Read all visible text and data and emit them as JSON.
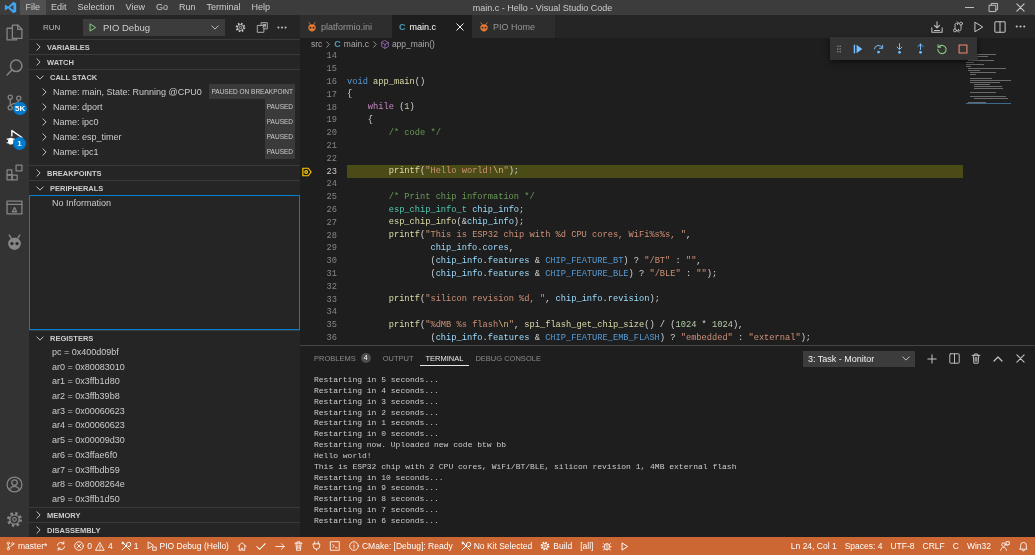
{
  "window": {
    "title": "main.c - Hello - Visual Studio Code"
  },
  "menu": [
    {
      "label": "File",
      "selected": true
    },
    {
      "label": "Edit",
      "selected": false
    },
    {
      "label": "Selection",
      "selected": false
    },
    {
      "label": "View",
      "selected": false
    },
    {
      "label": "Go",
      "selected": false
    },
    {
      "label": "Run",
      "selected": false
    },
    {
      "label": "Terminal",
      "selected": false
    },
    {
      "label": "Help",
      "selected": false
    }
  ],
  "activity_bar": {
    "items": [
      {
        "selected": false
      },
      {
        "selected": false
      },
      {
        "selected": false,
        "badge": "5K"
      },
      {
        "selected": true,
        "badge": "1"
      },
      {
        "selected": false
      },
      {
        "selected": false
      },
      {
        "selected": false
      }
    ]
  },
  "run_view": {
    "title": "RUN",
    "configuration": "PIO Debug",
    "sections": [
      {
        "title": "VARIABLES",
        "expanded": false,
        "focused": false
      },
      {
        "title": "WATCH",
        "expanded": false,
        "focused": false
      },
      {
        "title": "CALL STACK",
        "expanded": true,
        "focused": false,
        "threads": [
          {
            "label": "Name: main, State: Running @CPU0",
            "status": "PAUSED ON BREAKPOINT",
            "expanded": false
          },
          {
            "label": "Name: dport",
            "status": "PAUSED",
            "expanded": false
          },
          {
            "label": "Name: ipc0",
            "status": "PAUSED",
            "expanded": false
          },
          {
            "label": "Name: esp_timer",
            "status": "PAUSED",
            "expanded": false
          },
          {
            "label": "Name: ipc1",
            "status": "PAUSED",
            "expanded": false
          }
        ]
      },
      {
        "title": "BREAKPOINTS",
        "expanded": false,
        "focused": false
      },
      {
        "title": "PERIPHERALS",
        "expanded": true,
        "focused": true,
        "message": "No Information"
      },
      {
        "title": "REGISTERS",
        "expanded": true,
        "focused": false,
        "registers": [
          "pc = 0x400d09bf",
          "ar0 = 0x80083010",
          "ar1 = 0x3ffb1d80",
          "ar2 = 0x3ffb39b8",
          "ar3 = 0x00060623",
          "ar4 = 0x00060623",
          "ar5 = 0x00009d30",
          "ar6 = 0x3ffae6f0",
          "ar7 = 0x3ffbdb59",
          "ar8 = 0x8008264e",
          "ar9 = 0x3ffb1d50"
        ]
      },
      {
        "title": "MEMORY",
        "expanded": false,
        "focused": false
      },
      {
        "title": "DISASSEMBLY",
        "expanded": false,
        "focused": false
      }
    ]
  },
  "editor": {
    "tabs": [
      {
        "label": "platformio.ini",
        "kind": "platformio",
        "selected": false
      },
      {
        "label": "main.c",
        "kind": "source",
        "icon_letter": "C",
        "selected": true
      },
      {
        "label": "PIO Home",
        "kind": "platformio",
        "selected": false
      }
    ],
    "breadcrumb": [
      {
        "label": "src",
        "kind": "folder"
      },
      {
        "label": "main.c",
        "kind": "source",
        "icon_letter": "C"
      },
      {
        "label": "app_main()",
        "kind": "function"
      }
    ],
    "lines": [
      {
        "number": "14",
        "current": false
      },
      {
        "number": "15",
        "current": false
      },
      {
        "number": "16",
        "current": false,
        "tokens": [
          {
            "text": "void",
            "kind": "keyword"
          },
          {
            "text": " app_main",
            "kind": "function"
          },
          {
            "text": "()",
            "kind": "plain"
          }
        ]
      },
      {
        "number": "17",
        "current": false,
        "tokens": [
          {
            "text": "{",
            "kind": "plain"
          }
        ]
      },
      {
        "number": "18",
        "current": false,
        "tokens": [
          {
            "text": "    while",
            "kind": "control"
          },
          {
            "text": " (",
            "kind": "plain"
          },
          {
            "text": "1",
            "kind": "number"
          },
          {
            "text": ")",
            "kind": "plain"
          }
        ]
      },
      {
        "number": "19",
        "current": false,
        "tokens": [
          {
            "text": "    {",
            "kind": "plain"
          }
        ]
      },
      {
        "number": "20",
        "current": false,
        "tokens": [
          {
            "text": "        /* code */",
            "kind": "comment"
          }
        ]
      },
      {
        "number": "21",
        "current": false
      },
      {
        "number": "22",
        "current": false
      },
      {
        "number": "23",
        "current": true,
        "tokens": [
          {
            "text": "        printf",
            "kind": "function"
          },
          {
            "text": "(",
            "kind": "plain"
          },
          {
            "text": "\"Hello world!",
            "kind": "string"
          },
          {
            "text": "\\n",
            "kind": "escape"
          },
          {
            "text": "\"",
            "kind": "string"
          },
          {
            "text": ");",
            "kind": "plain"
          }
        ]
      },
      {
        "number": "24",
        "current": false
      },
      {
        "number": "25",
        "current": false,
        "tokens": [
          {
            "text": "        /* Print chip information */",
            "kind": "comment"
          }
        ]
      },
      {
        "number": "26",
        "current": false,
        "tokens": [
          {
            "text": "        esp_chip_info_t",
            "kind": "type"
          },
          {
            "text": " chip_info",
            "kind": "variable"
          },
          {
            "text": ";",
            "kind": "plain"
          }
        ]
      },
      {
        "number": "27",
        "current": false,
        "tokens": [
          {
            "text": "        esp_chip_info",
            "kind": "function"
          },
          {
            "text": "(&",
            "kind": "plain"
          },
          {
            "text": "chip_info",
            "kind": "variable"
          },
          {
            "text": ");",
            "kind": "plain"
          }
        ]
      },
      {
        "number": "28",
        "current": false,
        "tokens": [
          {
            "text": "        printf",
            "kind": "function"
          },
          {
            "text": "(",
            "kind": "plain"
          },
          {
            "text": "\"This is ESP32 chip with %d CPU cores, WiFi%s%s, \"",
            "kind": "string"
          },
          {
            "text": ",",
            "kind": "plain"
          }
        ]
      },
      {
        "number": "29",
        "current": false,
        "tokens": [
          {
            "text": "                chip_info",
            "kind": "variable"
          },
          {
            "text": ".",
            "kind": "plain"
          },
          {
            "text": "cores",
            "kind": "variable"
          },
          {
            "text": ",",
            "kind": "plain"
          }
        ]
      },
      {
        "number": "30",
        "current": false,
        "tokens": [
          {
            "text": "                (",
            "kind": "plain"
          },
          {
            "text": "chip_info",
            "kind": "variable"
          },
          {
            "text": ".",
            "kind": "plain"
          },
          {
            "text": "features",
            "kind": "variable"
          },
          {
            "text": " & ",
            "kind": "plain"
          },
          {
            "text": "CHIP_FEATURE_BT",
            "kind": "macro"
          },
          {
            "text": ") ? ",
            "kind": "plain"
          },
          {
            "text": "\"/BT\"",
            "kind": "string"
          },
          {
            "text": " : ",
            "kind": "plain"
          },
          {
            "text": "\"\"",
            "kind": "string"
          },
          {
            "text": ",",
            "kind": "plain"
          }
        ]
      },
      {
        "number": "31",
        "current": false,
        "tokens": [
          {
            "text": "                (",
            "kind": "plain"
          },
          {
            "text": "chip_info",
            "kind": "variable"
          },
          {
            "text": ".",
            "kind": "plain"
          },
          {
            "text": "features",
            "kind": "variable"
          },
          {
            "text": " & ",
            "kind": "plain"
          },
          {
            "text": "CHIP_FEATURE_BLE",
            "kind": "macro"
          },
          {
            "text": ") ? ",
            "kind": "plain"
          },
          {
            "text": "\"/BLE\"",
            "kind": "string"
          },
          {
            "text": " : ",
            "kind": "plain"
          },
          {
            "text": "\"\"",
            "kind": "string"
          },
          {
            "text": ");",
            "kind": "plain"
          }
        ]
      },
      {
        "number": "32",
        "current": false
      },
      {
        "number": "33",
        "current": false,
        "tokens": [
          {
            "text": "        printf",
            "kind": "function"
          },
          {
            "text": "(",
            "kind": "plain"
          },
          {
            "text": "\"silicon revision %d, \"",
            "kind": "string"
          },
          {
            "text": ", ",
            "kind": "plain"
          },
          {
            "text": "chip_info",
            "kind": "variable"
          },
          {
            "text": ".",
            "kind": "plain"
          },
          {
            "text": "revision",
            "kind": "variable"
          },
          {
            "text": ");",
            "kind": "plain"
          }
        ]
      },
      {
        "number": "34",
        "current": false
      },
      {
        "number": "35",
        "current": false,
        "tokens": [
          {
            "text": "        printf",
            "kind": "function"
          },
          {
            "text": "(",
            "kind": "plain"
          },
          {
            "text": "\"%dMB %s flash",
            "kind": "string"
          },
          {
            "text": "\\n",
            "kind": "escape"
          },
          {
            "text": "\"",
            "kind": "string"
          },
          {
            "text": ", ",
            "kind": "plain"
          },
          {
            "text": "spi_flash_get_chip_size",
            "kind": "function"
          },
          {
            "text": "() / (",
            "kind": "plain"
          },
          {
            "text": "1024",
            "kind": "number"
          },
          {
            "text": " * ",
            "kind": "plain"
          },
          {
            "text": "1024",
            "kind": "number"
          },
          {
            "text": "),",
            "kind": "plain"
          }
        ]
      },
      {
        "number": "36",
        "current": false,
        "tokens": [
          {
            "text": "                (",
            "kind": "plain"
          },
          {
            "text": "chip_info",
            "kind": "variable"
          },
          {
            "text": ".",
            "kind": "plain"
          },
          {
            "text": "features",
            "kind": "variable"
          },
          {
            "text": " & ",
            "kind": "plain"
          },
          {
            "text": "CHIP_FEATURE_EMB_FLASH",
            "kind": "macro"
          },
          {
            "text": ") ? ",
            "kind": "plain"
          },
          {
            "text": "\"embedded\"",
            "kind": "string"
          },
          {
            "text": " : ",
            "kind": "plain"
          },
          {
            "text": "\"external\"",
            "kind": "string"
          },
          {
            "text": ");",
            "kind": "plain"
          }
        ]
      }
    ]
  },
  "panel": {
    "tabs": [
      {
        "label": "PROBLEMS",
        "badge": "4",
        "selected": false
      },
      {
        "label": "OUTPUT",
        "selected": false
      },
      {
        "label": "TERMINAL",
        "selected": true
      },
      {
        "label": "DEBUG CONSOLE",
        "selected": false
      }
    ],
    "terminal_selector": "3: Task - Monitor",
    "terminal_lines": [
      "Restarting in 5 seconds...",
      "Restarting in 4 seconds...",
      "Restarting in 3 seconds...",
      "Restarting in 2 seconds...",
      "Restarting in 1 seconds...",
      "Restarting in 0 seconds...",
      "Restarting now. Uploaded new code btw bb",
      "Hello world!",
      "This is ESP32 chip with 2 CPU cores, WiFi/BT/BLE, silicon revision 1, 4MB external flash",
      "Restarting in 10 seconds...",
      "Restarting in 9 seconds...",
      "Restarting in 8 seconds...",
      "Restarting in 7 seconds...",
      "Restarting in 6 seconds..."
    ]
  },
  "status_bar": {
    "branch": "master*",
    "errors": "0",
    "warnings": "4",
    "tasks": "1",
    "debug_configuration": "PIO Debug (Hello)",
    "cmake_status": "CMake: [Debug]: Ready",
    "kit": "No Kit Selected",
    "build": "Build",
    "build_target": "[all]",
    "cursor_position": "Ln 24, Col 1",
    "indentation": "Spaces: 4",
    "encoding": "UTF-8",
    "line_ending": "CRLF",
    "language": "C",
    "platform": "Win32"
  }
}
